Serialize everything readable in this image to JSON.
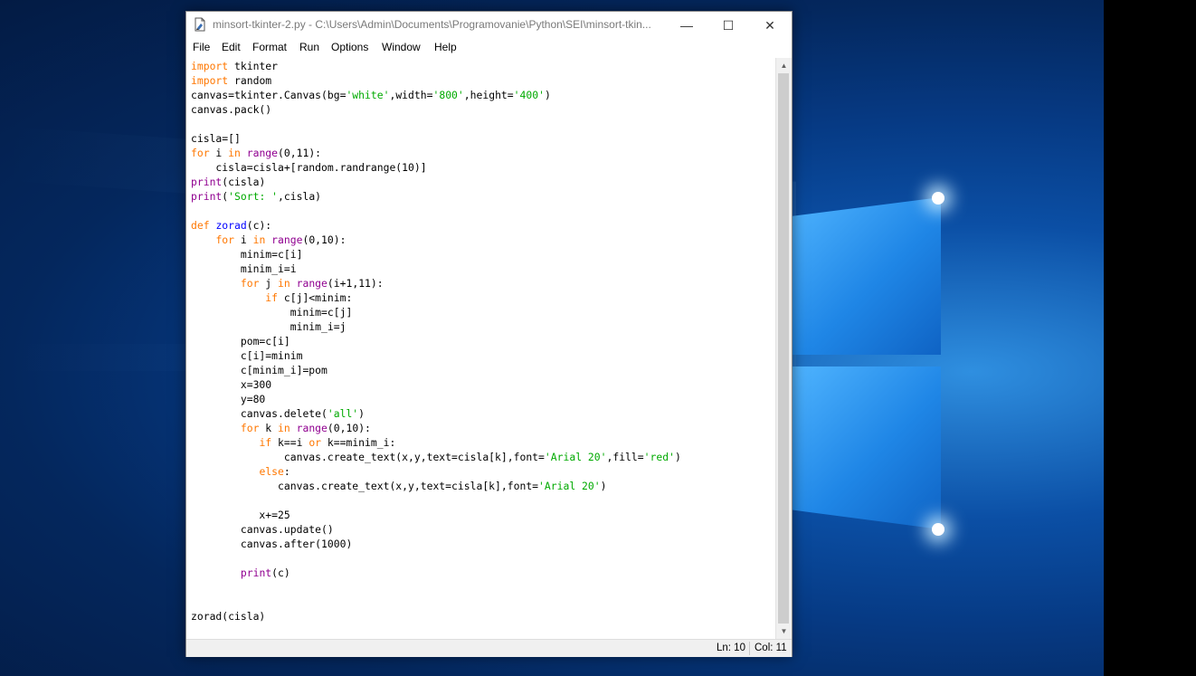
{
  "window": {
    "title": "minsort-tkinter-2.py - C:\\Users\\Admin\\Documents\\Programovanie\\Python\\SEI\\minsort-tkin...",
    "minimize_glyph": "—",
    "maximize_glyph": "☐",
    "close_glyph": "✕"
  },
  "menu": [
    "File",
    "Edit",
    "Format",
    "Run",
    "Options",
    "Window",
    "Help"
  ],
  "code_lines": [
    "import tkinter",
    "import random",
    "canvas=tkinter.Canvas(bg='white',width='800',height='400')",
    "canvas.pack()",
    "",
    "cisla=[]",
    "for i in range(0,11):",
    "    cisla=cisla+[random.randrange(10)]",
    "print(cisla)",
    "print('Sort: ',cisla)",
    "",
    "def zorad(c):",
    "    for i in range(0,10):",
    "        minim=c[i]",
    "        minim_i=i",
    "        for j in range(i+1,11):",
    "            if c[j]<minim:",
    "                minim=c[j]",
    "                minim_i=j",
    "        pom=c[i]",
    "        c[i]=minim",
    "        c[minim_i]=pom",
    "        x=300",
    "        y=80",
    "        canvas.delete('all')",
    "        for k in range(0,10):",
    "           if k==i or k==minim_i:",
    "               canvas.create_text(x,y,text=cisla[k],font='Arial 20',fill='red')",
    "           else:",
    "              canvas.create_text(x,y,text=cisla[k],font='Arial 20')",
    "",
    "           x+=25",
    "        canvas.update()",
    "        canvas.after(1000)",
    "",
    "        print(c)",
    "",
    "",
    "zorad(cisla)"
  ],
  "status": {
    "line": "Ln: 10",
    "col": "Col: 11"
  },
  "syntax_colors": {
    "keyword": "#ff7700",
    "builtin": "#900090",
    "string": "#00aa00",
    "definition": "#0000ff"
  }
}
